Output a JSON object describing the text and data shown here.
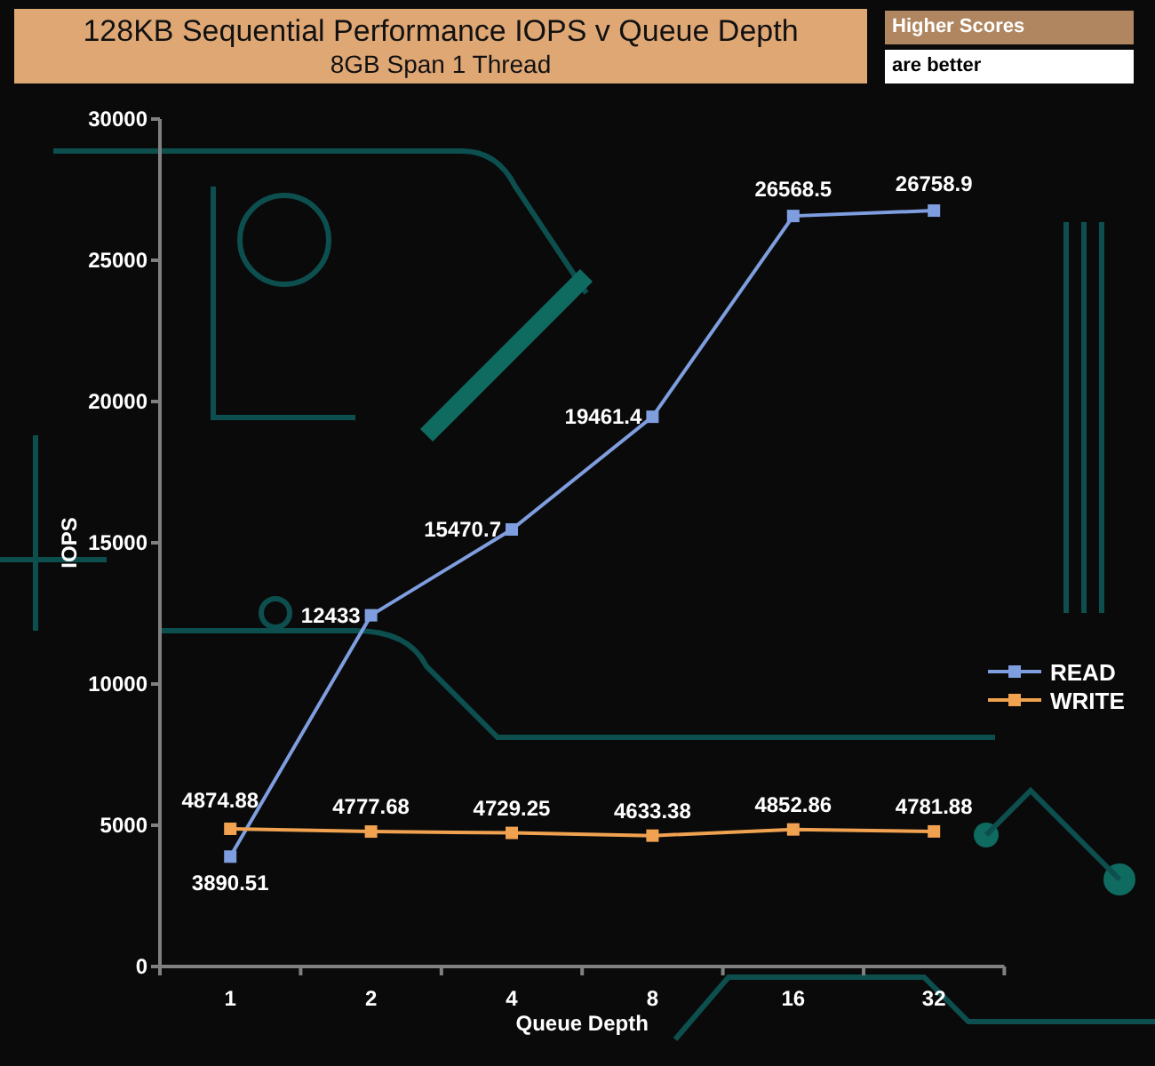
{
  "header": {
    "title": "128KB Sequential Performance IOPS v Queue Depth",
    "subtitle": "8GB Span 1 Thread"
  },
  "note": {
    "heading": "Higher Scores",
    "text": "are better"
  },
  "chart": {
    "chart_data": {
      "type": "line",
      "xlabel": "Queue Depth",
      "ylabel": "IOPS",
      "categories": [
        "1",
        "2",
        "4",
        "8",
        "16",
        "32"
      ],
      "ylim": [
        0,
        30000
      ],
      "yticks": [
        0,
        5000,
        10000,
        15000,
        20000,
        25000,
        30000
      ],
      "data_labels": true,
      "series": [
        {
          "name": "READ",
          "color": "#7f9ee0",
          "marker": "square",
          "values": [
            3890.51,
            12433,
            15470.7,
            19461.4,
            26568.5,
            26758.9
          ]
        },
        {
          "name": "WRITE",
          "color": "#f0a250",
          "marker": "square",
          "values": [
            4874.88,
            4777.68,
            4729.25,
            4633.38,
            4852.86,
            4781.88
          ]
        }
      ],
      "legend": true
    }
  }
}
